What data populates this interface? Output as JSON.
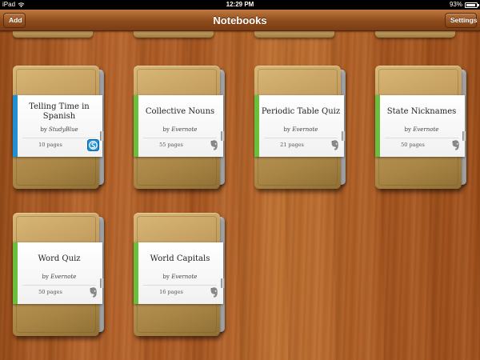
{
  "status_bar": {
    "carrier": "iPad",
    "time": "12:29 PM",
    "battery": "93%",
    "battery_level": 0.93
  },
  "nav": {
    "title": "Notebooks",
    "add_label": "Add",
    "settings_label": "Settings"
  },
  "colors": {
    "studyblue": "#1f8fd6",
    "evernote": "#6cbf3c"
  },
  "notebooks": [
    {
      "title": "Telling Time in Spanish",
      "by": "by",
      "author": "StudyBlue",
      "pages": "10 pages",
      "source_icon": "studyblue-icon",
      "stripe_color": "#1f8fd6"
    },
    {
      "title": "Collective Nouns",
      "by": "by",
      "author": "Evernote",
      "pages": "55 pages",
      "source_icon": "evernote-icon",
      "stripe_color": "#6cbf3c"
    },
    {
      "title": "Periodic Table Quiz",
      "by": "by",
      "author": "Evernote",
      "pages": "21 pages",
      "source_icon": "evernote-icon",
      "stripe_color": "#6cbf3c"
    },
    {
      "title": "State Nicknames",
      "by": "by",
      "author": "Evernote",
      "pages": "50 pages",
      "source_icon": "evernote-icon",
      "stripe_color": "#6cbf3c"
    },
    {
      "title": "Word Quiz",
      "by": "by",
      "author": "Evernote",
      "pages": "50 pages",
      "source_icon": "evernote-icon",
      "stripe_color": "#6cbf3c"
    },
    {
      "title": "World Capitals",
      "by": "by",
      "author": "Evernote",
      "pages": "16 pages",
      "source_icon": "evernote-icon",
      "stripe_color": "#6cbf3c"
    }
  ]
}
